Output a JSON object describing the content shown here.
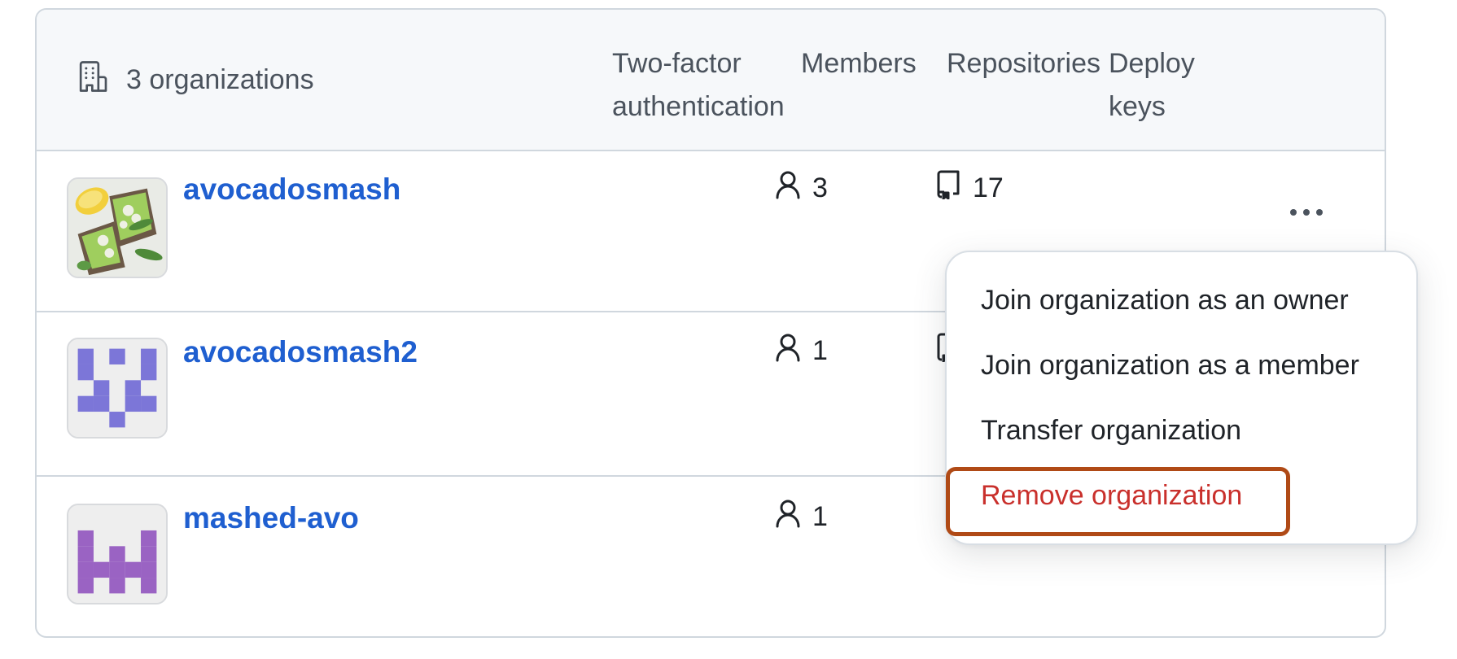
{
  "header": {
    "title": "3 organizations",
    "title_icon": "organization-icon",
    "columns": [
      {
        "label": "Two-factor authentication",
        "line1": "Two-factor",
        "line2": "authentication"
      },
      {
        "label": "Members",
        "line1": "Members",
        "line2": ""
      },
      {
        "label": "Repositories",
        "line1": "Repositories",
        "line2": ""
      },
      {
        "label": "Deploy keys",
        "line1": "Deploy",
        "line2": "keys"
      }
    ]
  },
  "organizations": [
    {
      "name": "avocadosmash",
      "avatar": "photo-avocado-toast",
      "members": "3",
      "repositories": "17",
      "show_actions": true
    },
    {
      "name": "avocadosmash2",
      "avatar": "identicon",
      "identicon_color": "#7c76d8",
      "identicon_grid": [
        [
          1,
          0,
          1,
          0,
          1
        ],
        [
          1,
          0,
          0,
          0,
          1
        ],
        [
          0,
          1,
          0,
          1,
          0
        ],
        [
          1,
          1,
          0,
          1,
          1
        ],
        [
          0,
          0,
          1,
          0,
          0
        ]
      ],
      "members": "1",
      "repositories": ""
    },
    {
      "name": "mashed-avo",
      "avatar": "identicon",
      "identicon_color": "#9a63c3",
      "identicon_grid": [
        [
          0,
          0,
          0,
          0,
          0
        ],
        [
          1,
          0,
          0,
          0,
          1
        ],
        [
          1,
          0,
          1,
          0,
          1
        ],
        [
          1,
          1,
          1,
          1,
          1
        ],
        [
          1,
          0,
          1,
          0,
          1
        ]
      ],
      "members": "1",
      "repositories": ""
    }
  ],
  "actions_menu": {
    "trigger_icon": "kebab-horizontal-icon",
    "items": [
      {
        "label": "Join organization as an owner",
        "variant": "default"
      },
      {
        "label": "Join organization as a member",
        "variant": "default"
      },
      {
        "label": "Transfer organization",
        "variant": "default"
      },
      {
        "label": "Remove organization",
        "variant": "danger",
        "highlighted": true
      }
    ]
  },
  "colors": {
    "link": "#1f5fd0",
    "danger": "#c9302c",
    "highlight_outline": "#b04a16",
    "header_bg": "#f6f8fa",
    "border": "#d0d7de"
  }
}
